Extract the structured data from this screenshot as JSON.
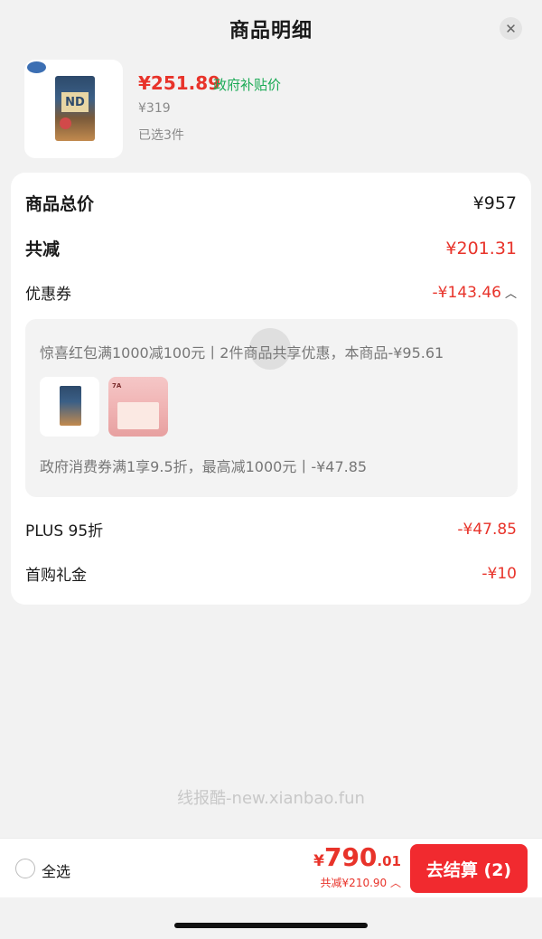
{
  "header": {
    "title": "商品明细",
    "close_icon": "close-icon"
  },
  "product": {
    "price": "¥251.89",
    "subsidy_tag": "政府补贴价",
    "original_price": "¥319",
    "selected": "已选3件"
  },
  "summary": {
    "total_label": "商品总价",
    "total_value": "¥957",
    "discount_label": "共减",
    "discount_value": "¥201.31",
    "coupon_label": "优惠券",
    "coupon_value": "-¥143.46",
    "coupon_toggle_icon": "chevron-up-icon",
    "coupon_detail_1": "惊喜红包满1000减100元丨2件商品共享优惠，本商品-¥95.61",
    "coupon_detail_2": "政府消费券满1享9.5折，最高减1000元丨-¥47.85",
    "plus_label": "PLUS 95折",
    "plus_value": "-¥47.85",
    "first_label": "首购礼金",
    "first_value": "-¥10"
  },
  "watermark": "线报酷-new.xianbao.fun",
  "bottom": {
    "select_all": "全选",
    "currency": "¥",
    "total_int": "790",
    "total_dec": ".01",
    "total_discount": "共减¥210.90",
    "checkout": "去结算 (2)"
  },
  "colors": {
    "accent_red": "#e8332a",
    "subsidy_green": "#1aaa55",
    "button_red": "#f12a2f"
  }
}
